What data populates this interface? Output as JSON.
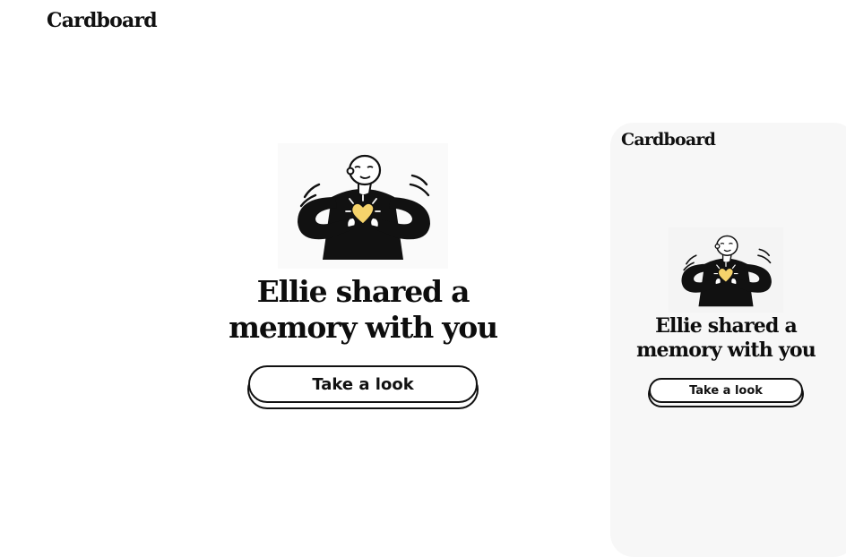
{
  "brand": {
    "name": "Cardboard"
  },
  "hero": {
    "illustration_icon": "person-hugging-heart-icon",
    "headline_line1": "Ellie shared a",
    "headline_line2": "memory with you",
    "cta_label": "Take a look"
  },
  "mobile_preview": {
    "brand": "Cardboard",
    "illustration_icon": "person-hugging-heart-icon",
    "headline_line1": "Ellie shared a",
    "headline_line2": "memory with you",
    "cta_label": "Take a look"
  },
  "colors": {
    "text": "#0d0d0d",
    "heart": "#f5d36b",
    "mobile_bg": "#f7f7f7",
    "page_bg": "#ffffff"
  }
}
